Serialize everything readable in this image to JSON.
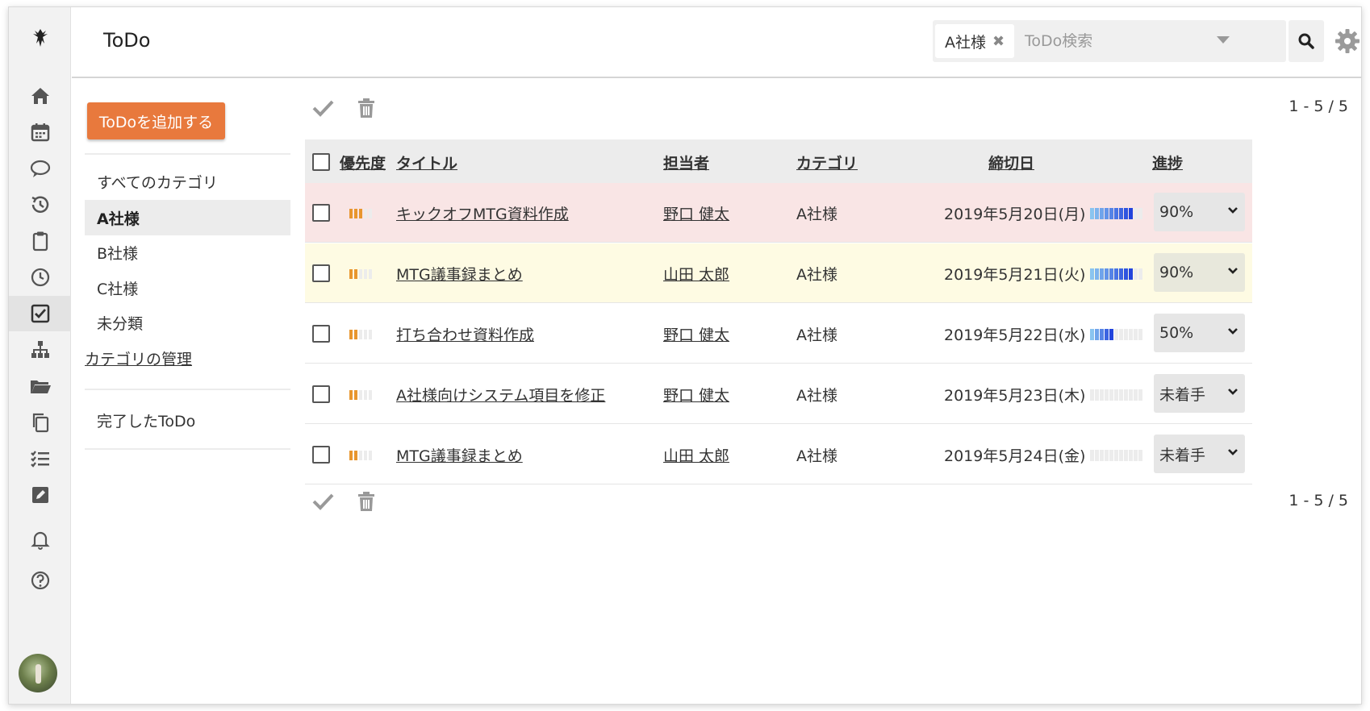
{
  "header": {
    "title": "ToDo",
    "filter_chip": "A社様",
    "search_placeholder": "ToDo検索"
  },
  "sidebar": {
    "add_button": "ToDoを追加する",
    "categories": [
      "すべてのカテゴリ",
      "A社様",
      "B社様",
      "C社様",
      "未分類"
    ],
    "active_category": "A社様",
    "manage_link": "カテゴリの管理",
    "completed_link": "完了したToDo"
  },
  "toolbar": {
    "pager": "1 - 5 / 5"
  },
  "table": {
    "columns": [
      "優先度",
      "タイトル",
      "担当者",
      "カテゴリ",
      "締切日",
      "進捗"
    ],
    "rows": [
      {
        "title": "キックオフMTG資料作成",
        "assignee": "野口 健太",
        "category": "A社様",
        "due": "2019年5月20日(月)",
        "progress": 0.9,
        "status": "90%",
        "priority": 3,
        "highlight": "#f9e5e5"
      },
      {
        "title": "MTG議事録まとめ",
        "assignee": "山田 太郎",
        "category": "A社様",
        "due": "2019年5月21日(火)",
        "progress": 0.9,
        "status": "90%",
        "priority": 2,
        "highlight": "#fefbe3"
      },
      {
        "title": "打ち合わせ資料作成",
        "assignee": "野口 健太",
        "category": "A社様",
        "due": "2019年5月22日(水)",
        "progress": 0.5,
        "status": "50%",
        "priority": 2,
        "highlight": "#ffffff"
      },
      {
        "title": "A社様向けシステム項目を修正",
        "assignee": "野口 健太",
        "category": "A社様",
        "due": "2019年5月23日(木)",
        "progress": 0,
        "status": "未着手",
        "priority": 2,
        "highlight": "#ffffff"
      },
      {
        "title": "MTG議事録まとめ",
        "assignee": "山田 太郎",
        "category": "A社様",
        "due": "2019年5月24日(金)",
        "progress": 0,
        "status": "未着手",
        "priority": 2,
        "highlight": "#ffffff"
      }
    ]
  },
  "colors": {
    "accent": "#e8793d",
    "priority": "#e8962e",
    "progress": "#3d6ee8"
  },
  "rail_icons": [
    "logo-icon",
    "home-icon",
    "calendar-icon",
    "chat-icon",
    "history-icon",
    "clipboard-icon",
    "clock-icon",
    "todo-icon",
    "org-icon",
    "folder-icon",
    "copy-icon",
    "checklist-icon",
    "edit-icon",
    "bell-icon",
    "help-icon"
  ]
}
